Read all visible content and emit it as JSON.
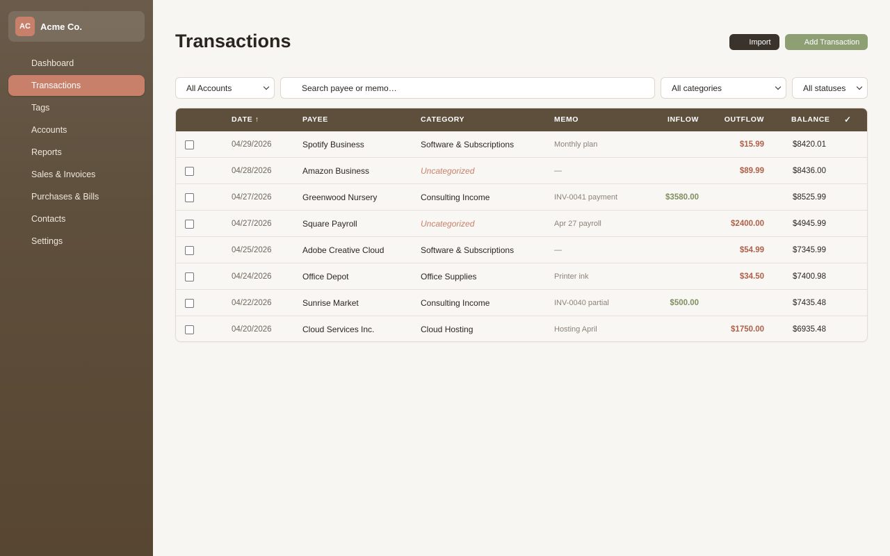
{
  "org": {
    "initials": "AC",
    "name": "Acme Co."
  },
  "nav": [
    {
      "label": "Dashboard",
      "active": false
    },
    {
      "label": "Transactions",
      "active": true
    },
    {
      "label": "Tags",
      "active": false
    },
    {
      "label": "Accounts",
      "active": false
    },
    {
      "label": "Reports",
      "active": false
    },
    {
      "label": "Sales & Invoices",
      "active": false
    },
    {
      "label": "Purchases & Bills",
      "active": false
    },
    {
      "label": "Contacts",
      "active": false
    },
    {
      "label": "Settings",
      "active": false
    }
  ],
  "page": {
    "title": "Transactions"
  },
  "actions": {
    "import": "Import",
    "add": "Add Transaction"
  },
  "filters": {
    "accounts": "All Accounts",
    "search_placeholder": "Search payee or memo…",
    "categories": "All categories",
    "statuses": "All statuses"
  },
  "table": {
    "headers": {
      "date": "DATE ↑",
      "payee": "PAYEE",
      "category": "CATEGORY",
      "memo": "MEMO",
      "inflow": "INFLOW",
      "outflow": "OUTFLOW",
      "balance": "BALANCE",
      "reconciled": "✓"
    },
    "rows": [
      {
        "date": "04/29/2026",
        "payee": "Spotify Business",
        "category": "Software & Subscriptions",
        "memo": "Monthly plan",
        "inflow": "",
        "outflow": "$15.99",
        "balance": "$8420.01"
      },
      {
        "date": "04/28/2026",
        "payee": "Amazon Business",
        "category": "Uncategorized",
        "memo": "—",
        "inflow": "",
        "outflow": "$89.99",
        "balance": "$8436.00"
      },
      {
        "date": "04/27/2026",
        "payee": "Greenwood Nursery",
        "category": "Consulting Income",
        "memo": "INV-0041 payment",
        "inflow": "$3580.00",
        "outflow": "",
        "balance": "$8525.99"
      },
      {
        "date": "04/27/2026",
        "payee": "Square Payroll",
        "category": "Uncategorized",
        "memo": "Apr 27 payroll",
        "inflow": "",
        "outflow": "$2400.00",
        "balance": "$4945.99"
      },
      {
        "date": "04/25/2026",
        "payee": "Adobe Creative Cloud",
        "category": "Software & Subscriptions",
        "memo": "—",
        "inflow": "",
        "outflow": "$54.99",
        "balance": "$7345.99"
      },
      {
        "date": "04/24/2026",
        "payee": "Office Depot",
        "category": "Office Supplies",
        "memo": "Printer ink",
        "inflow": "",
        "outflow": "$34.50",
        "balance": "$7400.98"
      },
      {
        "date": "04/22/2026",
        "payee": "Sunrise Market",
        "category": "Consulting Income",
        "memo": "INV-0040 partial",
        "inflow": "$500.00",
        "outflow": "",
        "balance": "$7435.48"
      },
      {
        "date": "04/20/2026",
        "payee": "Cloud Services Inc.",
        "category": "Cloud Hosting",
        "memo": "Hosting April",
        "inflow": "",
        "outflow": "$1750.00",
        "balance": "$6935.48"
      }
    ]
  },
  "colors": {
    "sidebar": "#5e4e3c",
    "accent": "#c9806a",
    "inflow": "#7d8f5e",
    "outflow": "#b0604a",
    "add_button": "#8d9f73"
  }
}
